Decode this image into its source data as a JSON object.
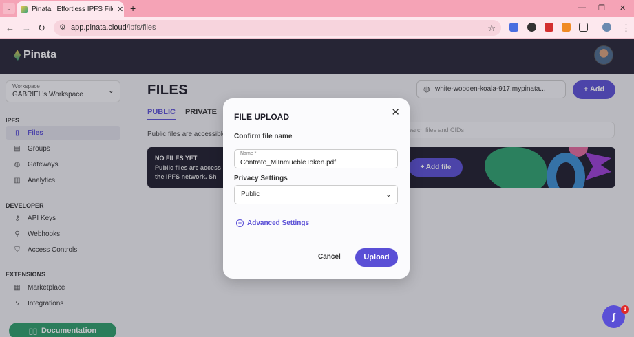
{
  "browser": {
    "tab_title": "Pinata | Effortless IPFS File Mana",
    "new_tab": "+",
    "url_host": "app.pinata.cloud",
    "url_path": "/ipfs/files"
  },
  "app": {
    "brand": "Pinata",
    "workspace_label": "Workspace",
    "workspace_name": "GABRIEL's Workspace",
    "sections": {
      "ipfs": "IPFS",
      "developer": "DEVELOPER",
      "extensions": "EXTENSIONS"
    },
    "ipfs_items": [
      "Files",
      "Groups",
      "Gateways",
      "Analytics"
    ],
    "developer_items": [
      "API Keys",
      "Webhooks",
      "Access Controls"
    ],
    "extensions_items": [
      "Marketplace",
      "Integrations"
    ],
    "documentation": "Documentation"
  },
  "content": {
    "title": "FILES",
    "gateway": "white-wooden-koala-917.mypinata...",
    "add_label": "+ Add",
    "tab_public": "PUBLIC",
    "tab_private": "PRIVATE",
    "description": "Public files are accessible",
    "search_placeholder": "earch files and CIDs",
    "banner_title": "NO FILES YET",
    "banner_text": "Public files are access the IPFS network. Sh",
    "add_file": "+ Add file"
  },
  "modal": {
    "title": "FILE UPLOAD",
    "close": "✕",
    "confirm_label": "Confirm file name",
    "name_label": "Name *",
    "name_value": "Contrato_MiInmuebleToken.pdf",
    "privacy_label": "Privacy Settings",
    "privacy_value": "Public",
    "advanced": "Advanced Settings",
    "cancel": "Cancel",
    "upload": "Upload"
  },
  "chat": {
    "badge": "1"
  },
  "colors": {
    "accent": "#5a4fd6",
    "header": "#262435",
    "tabbar": "#f5a3b6",
    "docs_button": "#2d9f6a"
  }
}
